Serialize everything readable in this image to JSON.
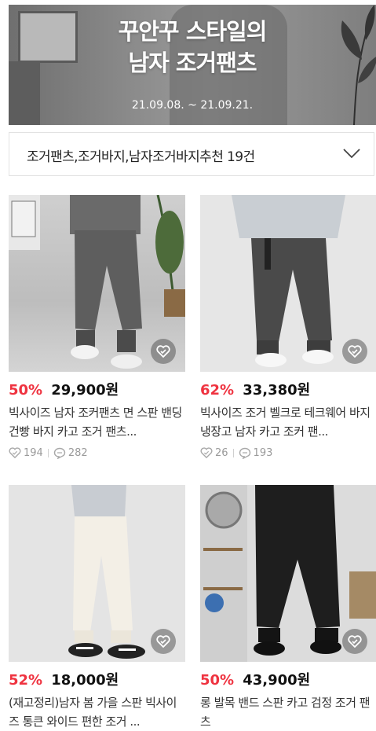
{
  "banner": {
    "title_line1": "꾸안꾸 스타일의",
    "title_line2": "남자 조거팬츠",
    "date_range": "21.09.08. ~ 21.09.21."
  },
  "filter": {
    "label": "조거팬츠,조거바지,남자조거바지추천 19건",
    "icon": "chevron-down-icon"
  },
  "products": [
    {
      "discount": "50%",
      "price": "29,900원",
      "title": "빅사이즈 남자 조커팬츠 면 스판 밴딩 건빵 바지 카고 조거 팬츠...",
      "likes": "194",
      "reviews": "282"
    },
    {
      "discount": "62%",
      "price": "33,380원",
      "title": "빅사이즈 조거 벨크로 테크웨어 바지 냉장고 남자 카고 조커 팬...",
      "likes": "26",
      "reviews": "193"
    },
    {
      "discount": "52%",
      "price": "18,000원",
      "title": "(재고정리)남자 봄 가을 스판 빅사이즈 통큰 와이드 편한 조거 ..."
    },
    {
      "discount": "50%",
      "price": "43,900원",
      "title": "롱 발목 밴드 스판 카고 검정 조거 팬츠"
    }
  ],
  "colors": {
    "discount": "#ef3340",
    "stat_gray": "#9a9a9a"
  }
}
